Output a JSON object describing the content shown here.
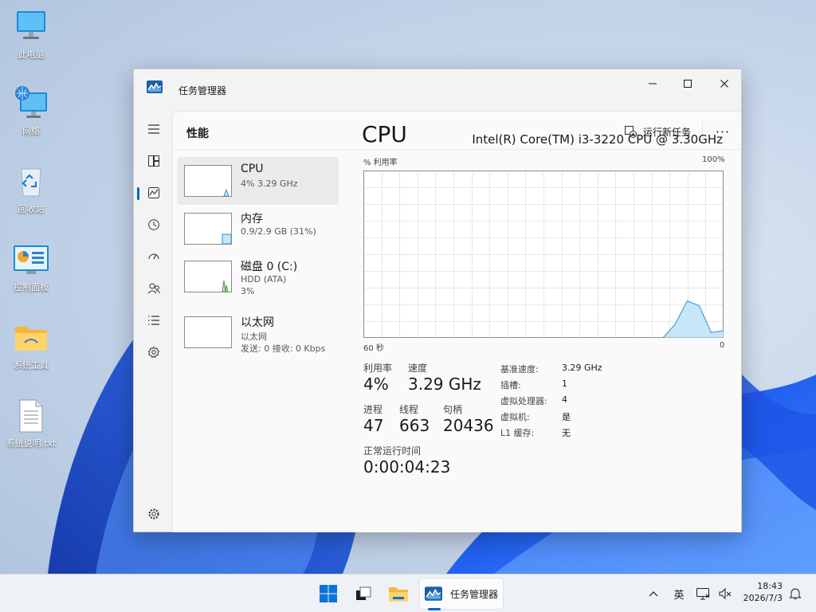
{
  "desktop": {
    "icons": [
      {
        "label": "此电脑",
        "icon": "this-pc-icon"
      },
      {
        "label": "网络",
        "icon": "network-icon"
      },
      {
        "label": "回收站",
        "icon": "recycle-bin-icon"
      },
      {
        "label": "控制面板",
        "icon": "control-panel-icon"
      },
      {
        "label": "系统工具",
        "icon": "folder-icon"
      },
      {
        "label": "系统说明.txt",
        "icon": "text-file-icon"
      }
    ]
  },
  "window": {
    "title": "任务管理器",
    "page_title": "性能",
    "run_new_task": "运行新任务",
    "more": "···"
  },
  "nav": {
    "items": [
      "menu-icon",
      "processes-icon",
      "performance-icon",
      "app-history-icon",
      "startup-apps-icon",
      "users-icon",
      "details-icon",
      "services-icon",
      "settings-icon"
    ],
    "active": "performance-icon"
  },
  "devices": [
    {
      "name": "CPU",
      "sub": "4% 3.29 GHz",
      "sub2": "",
      "color": "#2f8fd8",
      "selected": true
    },
    {
      "name": "内存",
      "sub": "0.9/2.9 GB (31%)",
      "sub2": "",
      "color": "#2f8fd8",
      "fill_percent": 31,
      "selected": false
    },
    {
      "name": "磁盘 0 (C:)",
      "sub": "HDD (ATA)",
      "sub2": "3%",
      "color": "#4a9b3e",
      "selected": false
    },
    {
      "name": "以太网",
      "sub": "以太网",
      "sub2": "发送: 0 接收: 0 Kbps",
      "color": "#a65fb8",
      "selected": false
    }
  ],
  "cpu": {
    "title": "CPU",
    "model": "Intel(R) Core(TM) i3-3220 CPU @ 3.30GHz",
    "y_axis_label": "% 利用率",
    "y_axis_max": "100%",
    "x_axis_left": "60 秒",
    "x_axis_right": "0",
    "stats": {
      "utilization_label": "利用率",
      "utilization": "4%",
      "speed_label": "速度",
      "speed": "3.29 GHz",
      "processes_label": "进程",
      "processes": "47",
      "threads_label": "线程",
      "threads": "663",
      "handles_label": "句柄",
      "handles": "20436",
      "uptime_label": "正常运行时间",
      "uptime": "0:00:04:23"
    },
    "details": [
      {
        "key": "基准速度:",
        "value": "3.29 GHz"
      },
      {
        "key": "插槽:",
        "value": "1"
      },
      {
        "key": "虚拟处理器:",
        "value": "4"
      },
      {
        "key": "虚拟机:",
        "value": "是"
      },
      {
        "key": "L1 缓存:",
        "value": "无"
      }
    ]
  },
  "chart_data": {
    "type": "area",
    "x": [
      60,
      58,
      56,
      54,
      52,
      50,
      48,
      46,
      44,
      42,
      40,
      38,
      36,
      34,
      32,
      30,
      28,
      26,
      24,
      22,
      20,
      18,
      16,
      14,
      12,
      10,
      8,
      6,
      4,
      2,
      0
    ],
    "values": [
      0,
      0,
      0,
      0,
      0,
      0,
      0,
      0,
      0,
      0,
      0,
      0,
      0,
      0,
      0,
      0,
      0,
      0,
      0,
      0,
      0,
      0,
      0,
      0,
      0,
      0,
      8,
      22,
      19,
      3,
      4
    ],
    "ylim": [
      0,
      100
    ],
    "xlim": [
      60,
      0
    ],
    "xlabel": "60 秒",
    "ylabel": "% 利用率",
    "grid": true,
    "color": "#2f8fd8",
    "fill": "#c7e6f7"
  },
  "taskbar": {
    "items": [
      "start-icon",
      "task-view-icon",
      "file-explorer-icon"
    ],
    "active_app": "任务管理器",
    "ime": "英",
    "time": "18:43",
    "date": "2026/7/3"
  }
}
